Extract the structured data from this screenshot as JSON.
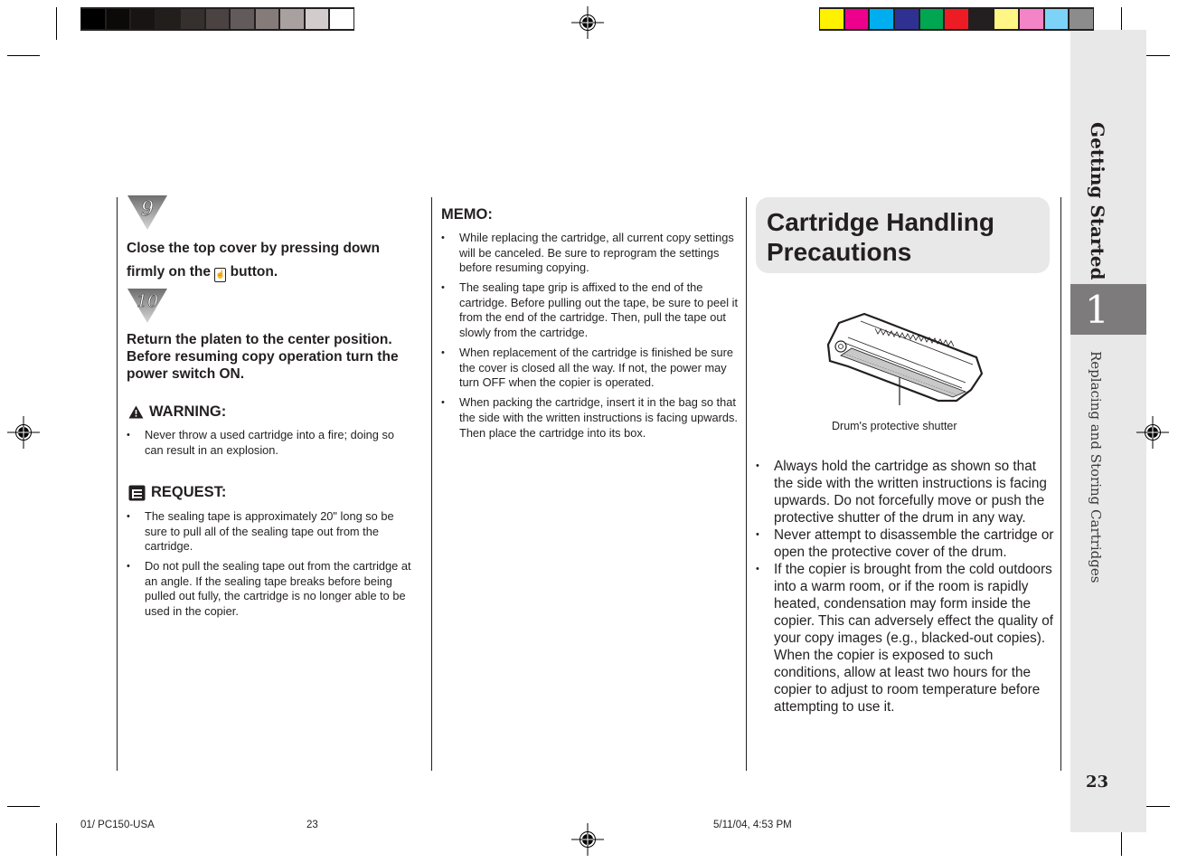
{
  "print_marks": {
    "grayscale_swatches": [
      "#000000",
      "#0c0a09",
      "#171413",
      "#221e1c",
      "#35302e",
      "#4a4342",
      "#625b5a",
      "#857c7a",
      "#a9a19f",
      "#d2cccc",
      "#ffffff"
    ],
    "color_swatches": [
      "#fff200",
      "#ec008c",
      "#00aeef",
      "#2e3192",
      "#00a651",
      "#ed1c24",
      "#231f20",
      "#fff685",
      "#f384c6",
      "#7dd3f7",
      "#8c8c8c"
    ]
  },
  "side_tab": {
    "section_title": "Getting Started",
    "chapter_number": "1",
    "subsection_title": "Replacing and Storing Cartridges",
    "page_number": "23"
  },
  "left_column": {
    "step9": {
      "number": "9",
      "text_before_icon": "Close the top cover by pressing down firmly on the",
      "text_after_icon": "button."
    },
    "step10": {
      "number": "10",
      "text": "Return the platen to the center position. Before resuming copy operation turn the power switch ON."
    },
    "warning": {
      "label": "WARNING:",
      "items": [
        "Never throw a used cartridge into a fire; doing so can result in an explosion."
      ]
    },
    "request": {
      "label": "REQUEST:",
      "items": [
        "The sealing tape is approximately 20\" long so be sure to pull all of the sealing tape out from the cartridge.",
        "Do not pull the sealing tape out from the cartridge at an angle. If the sealing tape breaks before being pulled out fully, the cartridge is no longer able to be used in the copier."
      ]
    }
  },
  "middle_column": {
    "memo": {
      "label": "MEMO:",
      "items": [
        "While replacing the cartridge, all current copy settings will be canceled. Be sure to reprogram the settings before resuming copying.",
        "The sealing tape grip is affixed to the end of the cartridge. Before pulling out the tape, be sure to peel it from the end of the cartridge. Then, pull the tape out slowly from the cartridge.",
        "When replacement of the cartridge is finished be sure the cover is closed all the way. If not, the power may turn OFF when the copier is operated.",
        "When packing the cartridge, insert it in the bag so that the side with the written instructions is facing upwards. Then place the cartridge into its box."
      ]
    }
  },
  "right_column": {
    "title_line1": "Cartridge Handling",
    "title_line2": "Precautions",
    "figure_caption": "Drum's protective shutter",
    "items": [
      "Always hold the cartridge as shown so that the side with the written instructions is facing upwards. Do not forcefully move or push the protective shutter of the drum in any way.",
      "Never attempt to disassemble the cartridge or open the protective cover of the drum.",
      "If the copier is brought from the cold outdoors into a warm room, or if the room is rapidly heated, condensation may form inside the copier. This can adversely effect the quality of your copy images (e.g., blacked-out copies). When the copier is exposed to such conditions, allow at least two hours for the copier to adjust to room temperature before attempting to use it."
    ]
  },
  "footer": {
    "file_name": "01/ PC150-USA",
    "page": "23",
    "timestamp": "5/11/04, 4:53 PM"
  }
}
